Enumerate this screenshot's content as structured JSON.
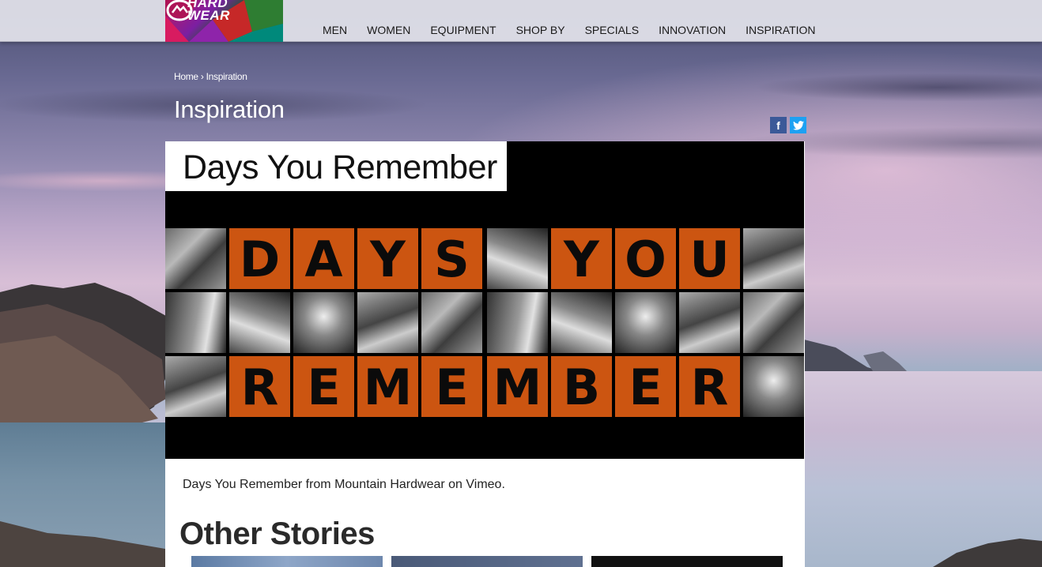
{
  "brand": {
    "logo_text_line1": "HARD",
    "logo_text_line2": "WEAR"
  },
  "nav": {
    "items": [
      {
        "label": "MEN"
      },
      {
        "label": "WOMEN"
      },
      {
        "label": "EQUIPMENT"
      },
      {
        "label": "SHOP BY"
      },
      {
        "label": "SPECIALS"
      },
      {
        "label": "INNOVATION"
      },
      {
        "label": "INSPIRATION"
      }
    ]
  },
  "breadcrumb": {
    "home": "Home",
    "separator": "›",
    "current": "Inspiration"
  },
  "page": {
    "title": "Inspiration"
  },
  "social": {
    "facebook_icon": "f",
    "twitter_icon": "twitter-bird"
  },
  "video": {
    "title": "Days You Remember",
    "row1_letters": [
      "D",
      "A",
      "Y",
      "S",
      "Y",
      "O",
      "U"
    ],
    "row3_letters": [
      "R",
      "E",
      "M",
      "E",
      "M",
      "B",
      "E",
      "R"
    ]
  },
  "caption": "Days You Remember from Mountain Hardwear on Vimeo.",
  "other_stories": {
    "title": "Other Stories"
  },
  "colors": {
    "accent_orange": "#cc5511",
    "facebook": "#3b5998",
    "twitter": "#1da1f2"
  }
}
